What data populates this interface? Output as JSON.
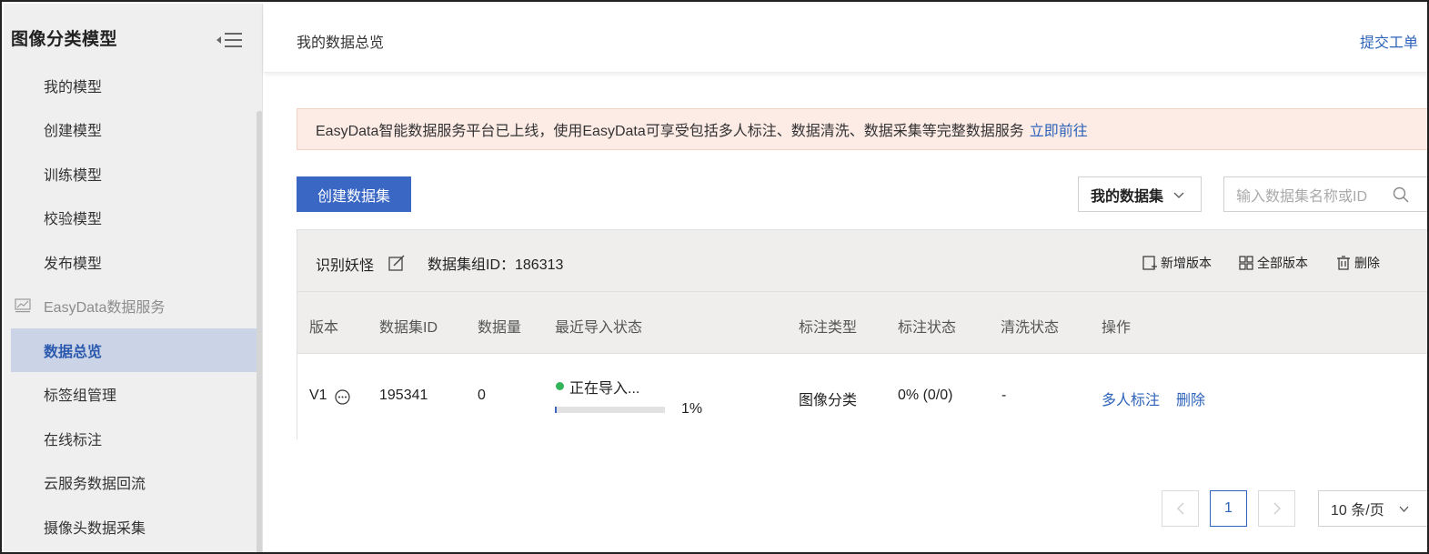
{
  "sidebar": {
    "title": "图像分类模型",
    "items": [
      {
        "label": "我的模型"
      },
      {
        "label": "创建模型"
      },
      {
        "label": "训练模型"
      },
      {
        "label": "校验模型"
      },
      {
        "label": "发布模型"
      }
    ],
    "group": {
      "label": "EasyData数据服务",
      "icon": "chart-icon"
    },
    "group_items": [
      {
        "label": "数据总览",
        "active": true
      },
      {
        "label": "标签组管理"
      },
      {
        "label": "在线标注"
      },
      {
        "label": "云服务数据回流"
      },
      {
        "label": "摄像头数据采集"
      }
    ]
  },
  "topbar": {
    "title": "我的数据总览",
    "link": "提交工单"
  },
  "notice": {
    "text": "EasyData智能数据服务平台已上线，使用EasyData可享受包括多人标注、数据清洗、数据采集等完整数据服务",
    "link": "立即前往"
  },
  "toolbar": {
    "create_label": "创建数据集",
    "dataset_filter": "我的数据集",
    "search_placeholder": "输入数据集名称或ID"
  },
  "dataset_group": {
    "name": "识别妖怪",
    "id_text": "数据集组ID：186313",
    "actions": {
      "add_version": "新增版本",
      "all_versions": "全部版本",
      "delete": "删除"
    }
  },
  "table": {
    "headers": {
      "version": "版本",
      "dataset_id": "数据集ID",
      "count": "数据量",
      "import_status": "最近导入状态",
      "label_type": "标注类型",
      "label_status": "标注状态",
      "clean_status": "清洗状态",
      "actions": "操作"
    },
    "rows": [
      {
        "version": "V1",
        "dataset_id": "195341",
        "count": "0",
        "import_status": "正在导入...",
        "import_progress": 0.01,
        "import_progress_text": "1%",
        "label_type": "图像分类",
        "label_status": "0% (0/0)",
        "clean_status": "-",
        "action_multi_label": "多人标注",
        "action_delete": "删除"
      }
    ]
  },
  "pagination": {
    "current_page": "1",
    "page_size": "10 条/页"
  },
  "colors": {
    "primary": "#3a66c4",
    "link": "#2d63b8",
    "active_bg": "#cbd3e6",
    "notice_bg": "#fdebe6",
    "status_ok": "#33b35a"
  }
}
